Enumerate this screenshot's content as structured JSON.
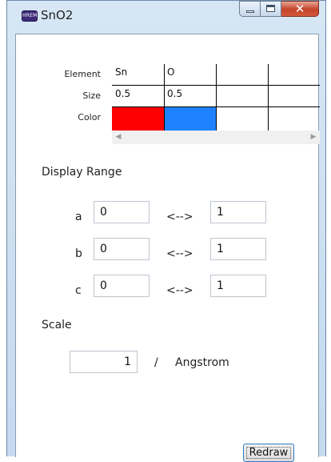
{
  "window": {
    "title": "SnO2",
    "app_icon_text": "HREM"
  },
  "element_table": {
    "row_labels": [
      "Element",
      "Size",
      "Color"
    ],
    "elements": [
      {
        "name": "Sn",
        "size": "0.5",
        "color": "#ff0000"
      },
      {
        "name": "O",
        "size": "0.5",
        "color": "#1e82ff"
      }
    ]
  },
  "display_range": {
    "heading": "Display Range",
    "separator": "<-->",
    "rows": [
      {
        "axis": "a",
        "from": "0",
        "to": "1"
      },
      {
        "axis": "b",
        "from": "0",
        "to": "1"
      },
      {
        "axis": "c",
        "from": "0",
        "to": "1"
      }
    ]
  },
  "scale": {
    "heading": "Scale",
    "value": "1",
    "slash": "/",
    "unit": "Angstrom"
  },
  "actions": {
    "redraw_label": "Redraw"
  }
}
